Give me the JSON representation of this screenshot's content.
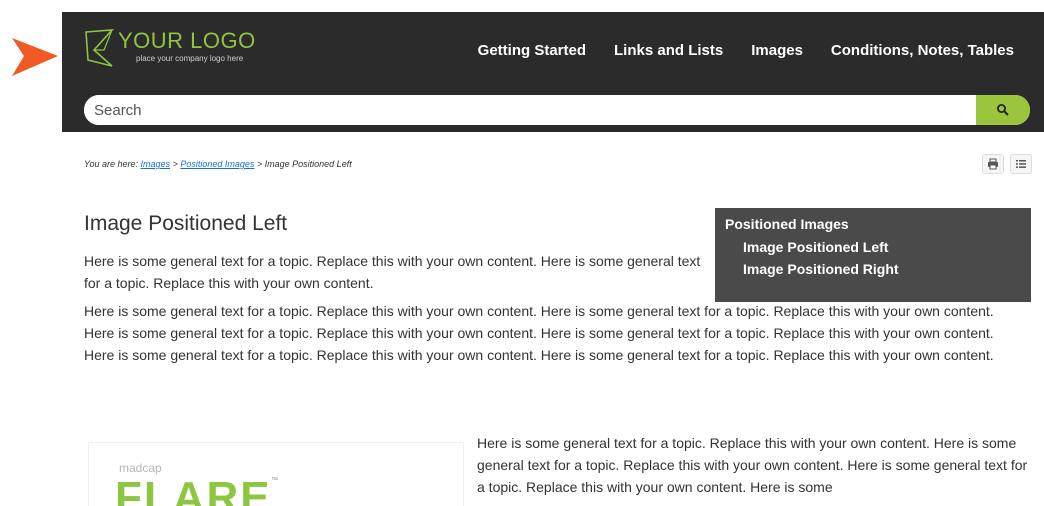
{
  "logo": {
    "title": "YOUR LOGO",
    "subtitle": "place your company logo here"
  },
  "nav": [
    {
      "label": "Getting Started"
    },
    {
      "label": "Links and Lists"
    },
    {
      "label": "Images"
    },
    {
      "label": "Conditions, Notes, Tables"
    }
  ],
  "search": {
    "placeholder": "Search"
  },
  "breadcrumbs": {
    "prefix": "You are here: ",
    "items": [
      "Images",
      "Positioned Images"
    ],
    "separator": " > ",
    "current": "Image Positioned Left"
  },
  "page": {
    "title": "Image Positioned Left",
    "para1": "Here is some general text for a topic. Replace this with your own content. Here is some general text for a topic. Replace this with your own content.",
    "para2": "Here is some general text for a topic. Replace this with your own content. Here is some general text for a topic. Replace this with your own content. Here is some general text for a topic. Replace this with your own content. Here is some general text for a topic. Replace this with your own content. Here is some general text for a topic. Replace this with your own content. Here is some general text for a topic. Replace this with your own content.",
    "para3": "Here is some general text for a topic. Replace this with your own content. Here is some general text for a topic. Replace this with your own content. Here is some general text for a topic. Replace this with your own content. Here is some"
  },
  "minitoc": {
    "title": "Positioned Images",
    "items": [
      "Image Positioned Left",
      "Image Positioned Right"
    ]
  },
  "image": {
    "brand_small": "madcap",
    "brand_large": "FLARE",
    "tm": "™"
  },
  "colors": {
    "header_bg": "#2b2b2b",
    "accent_green": "#8dc63f",
    "search_btn": "#9ac53d",
    "minitoc_bg": "#4a4a4a",
    "arrow": "#f15a24"
  },
  "icons": {
    "search": "magnifier-icon",
    "print": "printer-icon",
    "toc": "list-icon",
    "pointer": "arrow-pointer-icon"
  }
}
